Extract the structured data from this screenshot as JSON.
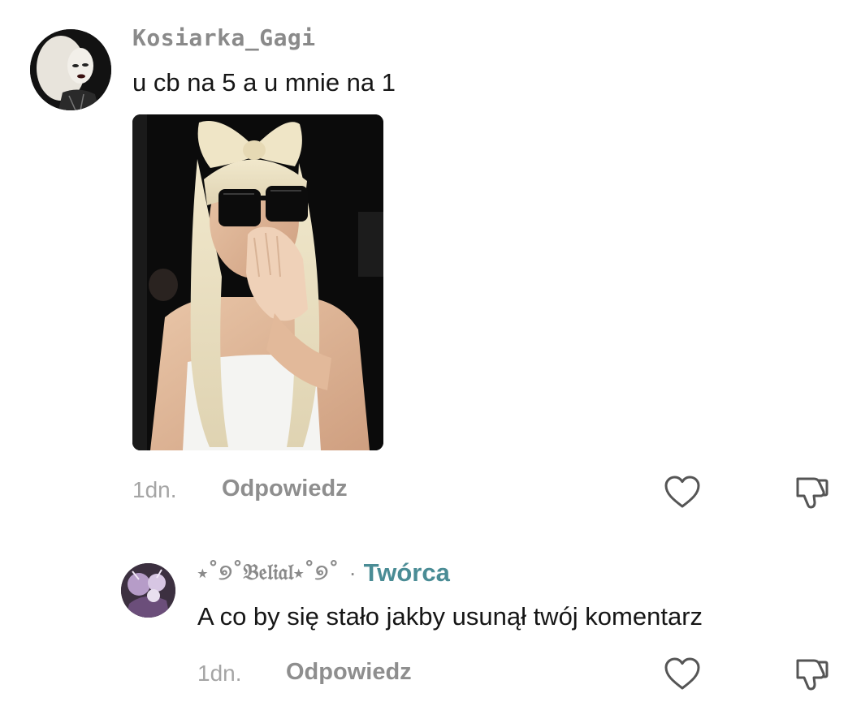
{
  "comments": [
    {
      "username": "Kosiarka_Gagi",
      "text": "u cb na 5 a u mnie na 1",
      "time": "1dn.",
      "reply_label": "Odpowiedz",
      "has_image": true
    },
    {
      "username": "⋆˚୭˚𝔅𝔢𝔩𝔦𝔞𝔩⋆˚୭˚",
      "separator": "·",
      "badge": "Twórca",
      "text": "A co by się stało jakby usunął twój komentarz",
      "time": "1dn.",
      "reply_label": "Odpowiedz"
    }
  ],
  "icons": {
    "like": "heart-outline-icon",
    "dislike": "thumbs-down-outline-icon"
  },
  "colors": {
    "username": "#8a8a8a",
    "creator_badge": "#4a8c95",
    "body_text": "#161616",
    "meta_text": "#a5a5a5",
    "icon_stroke": "#555555"
  }
}
